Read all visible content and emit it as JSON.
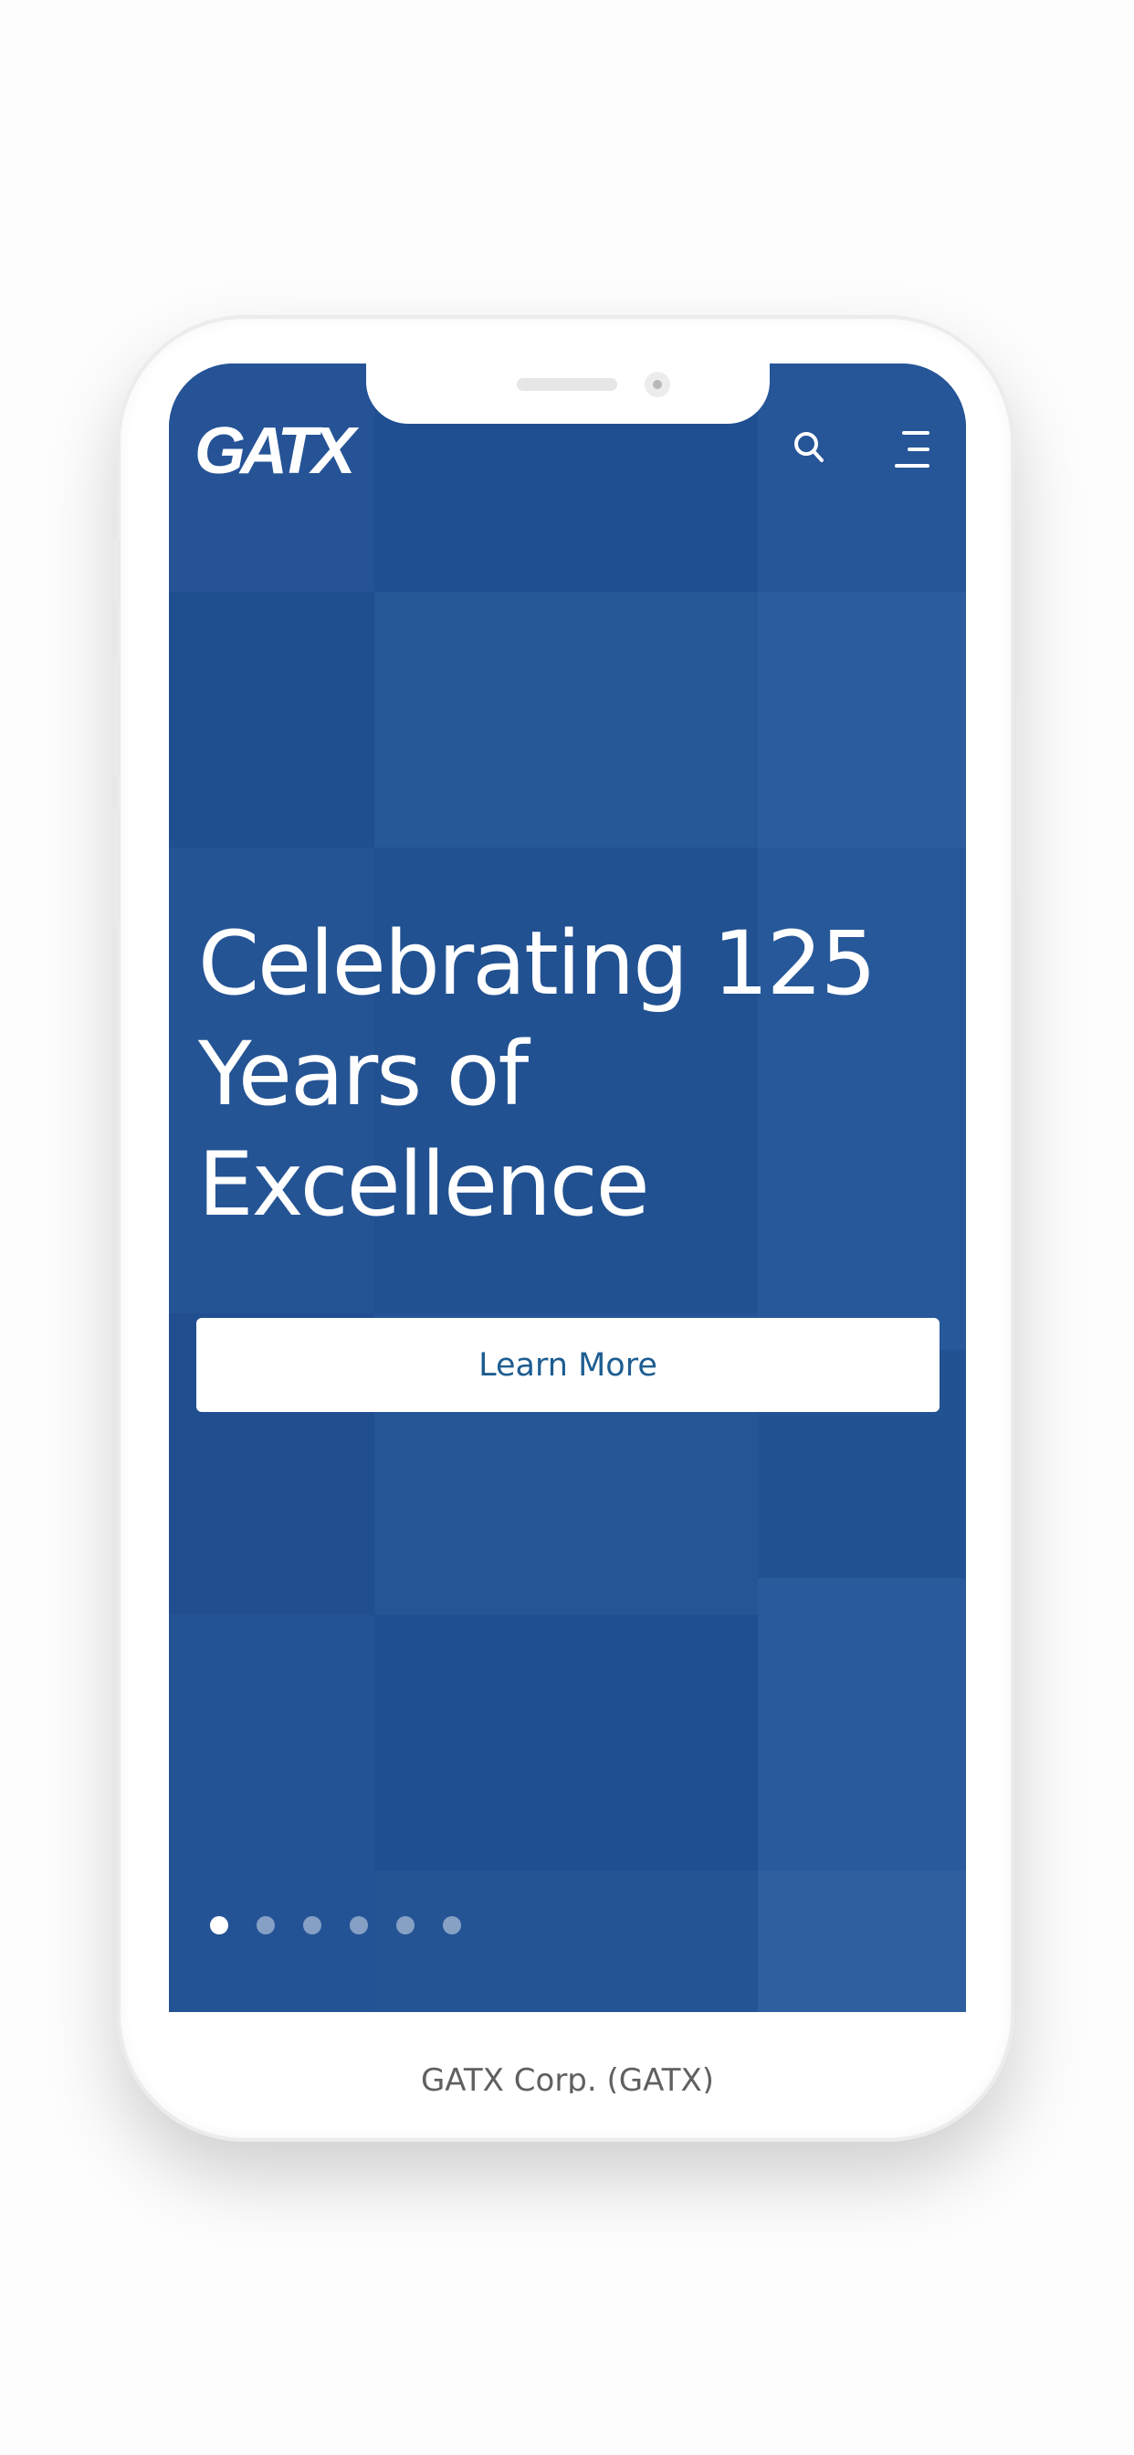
{
  "colors": {
    "hero_blue": "#1f5295",
    "button_text": "#1e5d91",
    "white": "#ffffff",
    "ticker_text": "#606060"
  },
  "header": {
    "logo_text": "GATX",
    "search_icon": "search-icon",
    "menu_icon": "hamburger-menu-icon"
  },
  "hero": {
    "headline_lines": [
      "Celebrating 125",
      "Years of",
      "Excellence"
    ],
    "cta_label": "Learn More",
    "carousel": {
      "slide_count": 6,
      "active_index": 0
    }
  },
  "ticker": {
    "label": "GATX Corp. (GATX)"
  }
}
